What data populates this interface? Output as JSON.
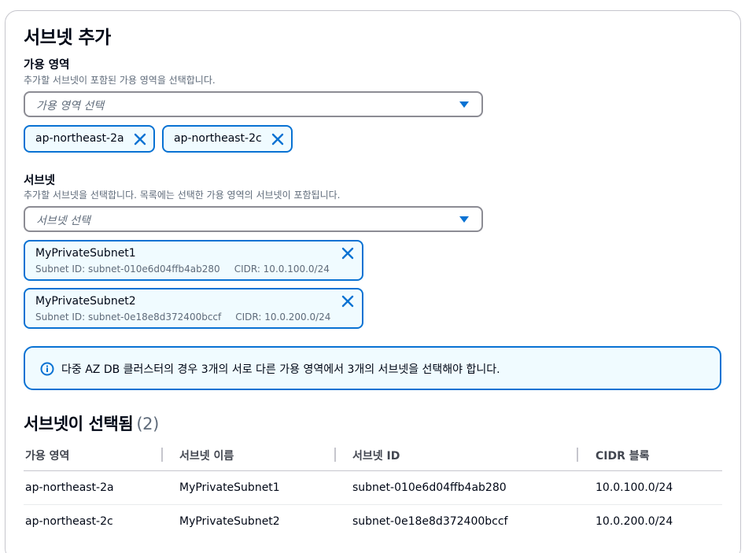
{
  "panel": {
    "title": "서브넷 추가"
  },
  "az": {
    "label": "가용 영역",
    "description": "추가할 서브넷이 포함된 가용 영역을 선택합니다.",
    "placeholder": "가용 영역 선택",
    "tokens": [
      "ap-northeast-2a",
      "ap-northeast-2c"
    ]
  },
  "subnet": {
    "label": "서브넷",
    "description": "추가할 서브넷을 선택합니다. 목록에는 선택한 가용 영역의 서브넷이 포함됩니다.",
    "placeholder": "서브넷 선택",
    "tokens": [
      {
        "name": "MyPrivateSubnet1",
        "id_text": "Subnet ID: subnet-010e6d04ffb4ab280",
        "cidr_text": "CIDR: 10.0.100.0/24"
      },
      {
        "name": "MyPrivateSubnet2",
        "id_text": "Subnet ID: subnet-0e18e8d372400bccf",
        "cidr_text": "CIDR: 10.0.200.0/24"
      }
    ]
  },
  "alert": {
    "message": "다중 AZ DB 클러스터의 경우 3개의 서로 다른 가용 영역에서 3개의 서브넷을 선택해야 합니다."
  },
  "selected": {
    "title": "서브넷이 선택됨",
    "count": "(2)",
    "columns": [
      "가용 영역",
      "서브넷 이름",
      "서브넷 ID",
      "CIDR 블록"
    ],
    "rows": [
      [
        "ap-northeast-2a",
        "MyPrivateSubnet1",
        "subnet-010e6d04ffb4ab280",
        "10.0.100.0/24"
      ],
      [
        "ap-northeast-2c",
        "MyPrivateSubnet2",
        "subnet-0e18e8d372400bccf",
        "10.0.200.0/24"
      ]
    ]
  },
  "colors": {
    "accent": "#0972d3",
    "token_bg": "#f0fbff",
    "text": "#000716",
    "muted": "#5f6b7a",
    "border": "#8c8c94"
  },
  "icons": {
    "dismiss": "close-icon",
    "dropdown": "caret-down-icon",
    "info": "info-icon"
  }
}
